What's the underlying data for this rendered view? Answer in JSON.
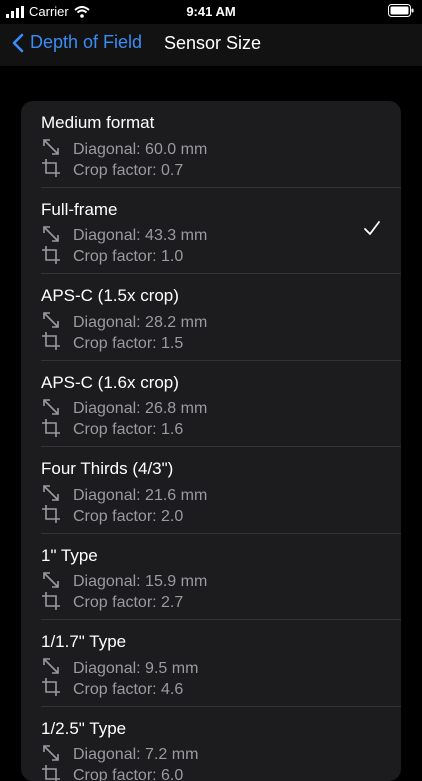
{
  "status": {
    "carrier": "Carrier",
    "time": "9:41 AM"
  },
  "nav": {
    "back_label": "Depth of Field",
    "title": "Sensor Size"
  },
  "sensors": [
    {
      "name": "Medium format",
      "diagonal": "Diagonal: 60.0 mm",
      "crop": "Crop factor: 0.7",
      "selected": false
    },
    {
      "name": "Full-frame",
      "diagonal": "Diagonal: 43.3 mm",
      "crop": "Crop factor: 1.0",
      "selected": true
    },
    {
      "name": "APS-C (1.5x crop)",
      "diagonal": "Diagonal: 28.2 mm",
      "crop": "Crop factor: 1.5",
      "selected": false
    },
    {
      "name": "APS-C (1.6x crop)",
      "diagonal": "Diagonal: 26.8 mm",
      "crop": "Crop factor: 1.6",
      "selected": false
    },
    {
      "name": "Four Thirds (4/3\")",
      "diagonal": "Diagonal: 21.6 mm",
      "crop": "Crop factor: 2.0",
      "selected": false
    },
    {
      "name": "1\" Type",
      "diagonal": "Diagonal: 15.9 mm",
      "crop": "Crop factor: 2.7",
      "selected": false
    },
    {
      "name": "1/1.7\" Type",
      "diagonal": "Diagonal: 9.5 mm",
      "crop": "Crop factor: 4.6",
      "selected": false
    },
    {
      "name": "1/2.5\" Type",
      "diagonal": "Diagonal: 7.2 mm",
      "crop": "Crop factor: 6.0",
      "selected": false
    }
  ],
  "icons": {
    "diagonal": "diagonal-arrows-icon",
    "crop": "crop-icon",
    "check": "checkmark-icon"
  },
  "colors": {
    "accent": "#3a8df7",
    "background": "#000000",
    "card": "#1c1c1e",
    "secondary_text": "#9a9aa0"
  }
}
